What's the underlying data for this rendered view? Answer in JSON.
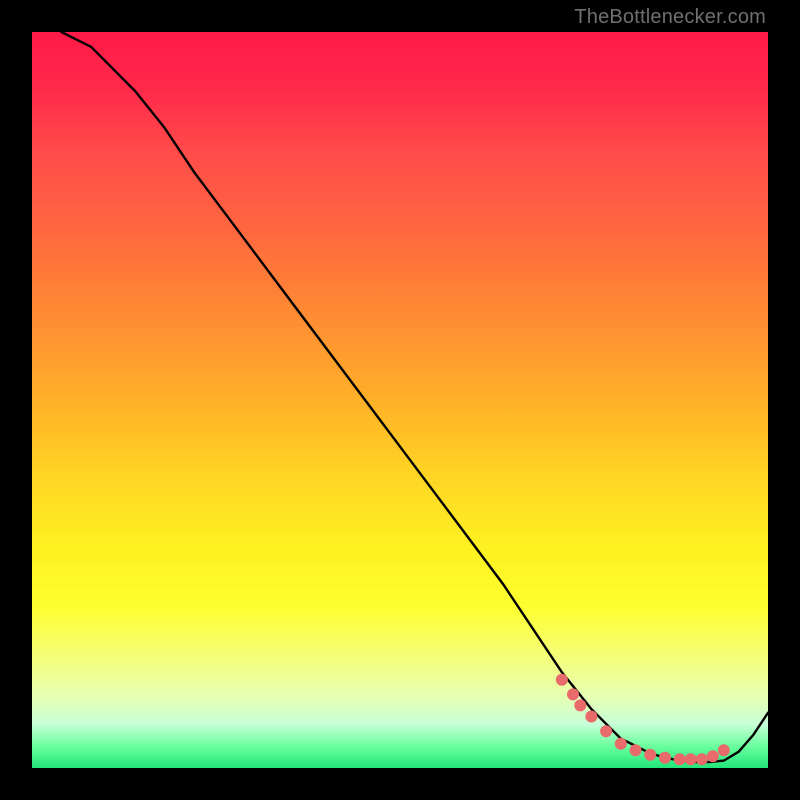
{
  "attribution": "TheBottlenecker.com",
  "chart_data": {
    "type": "line",
    "title": "",
    "xlabel": "",
    "ylabel": "",
    "xlim": [
      0,
      100
    ],
    "ylim": [
      0,
      100
    ],
    "series": [
      {
        "name": "curve",
        "x": [
          4,
          6,
          8,
          10,
          12,
          14,
          18,
          22,
          28,
          34,
          40,
          46,
          52,
          58,
          64,
          68,
          72,
          76,
          80,
          82,
          84,
          86,
          88,
          90,
          92,
          94,
          96,
          98,
          100
        ],
        "y": [
          100,
          99,
          98,
          96,
          94,
          92,
          87,
          81,
          73,
          65,
          57,
          49,
          41,
          33,
          25,
          19,
          13,
          8,
          4,
          3,
          2,
          1.4,
          1.0,
          0.8,
          0.8,
          1.0,
          2.2,
          4.5,
          7.5
        ]
      }
    ],
    "markers": {
      "comment": "salmon dots near the trough",
      "x": [
        72,
        73.5,
        74.5,
        76,
        78,
        80,
        82,
        84,
        86,
        88,
        89.5,
        91,
        92.5,
        94
      ],
      "y": [
        12,
        10,
        8.5,
        7,
        5,
        3.3,
        2.4,
        1.8,
        1.4,
        1.2,
        1.2,
        1.2,
        1.6,
        2.4
      ]
    },
    "colors": {
      "curve": "#000000",
      "marker": "#e96a6a"
    }
  }
}
